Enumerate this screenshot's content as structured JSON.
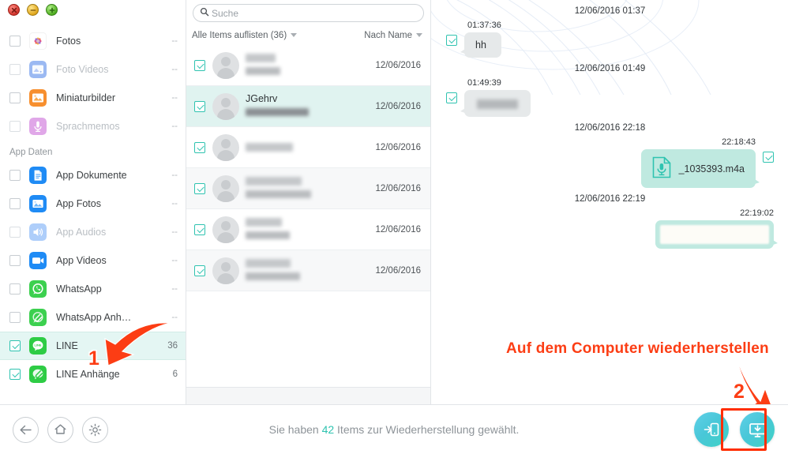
{
  "window": {
    "controls": [
      {
        "name": "close",
        "glyph": "x"
      },
      {
        "name": "minimize",
        "glyph": "-"
      },
      {
        "name": "maximize",
        "glyph": "+"
      }
    ]
  },
  "sidebar": {
    "items": [
      {
        "label": "Fotos",
        "icon": "photos-icon",
        "count": "--",
        "checked": false,
        "muted": false,
        "selected": false
      },
      {
        "label": "Foto Videos",
        "icon": "photo-videos-icon",
        "count": "--",
        "checked": false,
        "muted": true,
        "selected": false
      },
      {
        "label": "Miniaturbilder",
        "icon": "thumbnails-icon",
        "count": "--",
        "checked": false,
        "muted": false,
        "selected": false
      },
      {
        "label": "Sprachmemos",
        "icon": "voice-memos-icon",
        "count": "--",
        "checked": false,
        "muted": true,
        "selected": false
      }
    ],
    "group_label": "App Daten",
    "app_items": [
      {
        "label": "App Dokumente",
        "icon": "app-documents-icon",
        "count": "--",
        "checked": false,
        "muted": false,
        "selected": false
      },
      {
        "label": "App Fotos",
        "icon": "app-photos-icon",
        "count": "--",
        "checked": false,
        "muted": false,
        "selected": false
      },
      {
        "label": "App Audios",
        "icon": "app-audios-icon",
        "count": "--",
        "checked": false,
        "muted": true,
        "selected": false
      },
      {
        "label": "App Videos",
        "icon": "app-videos-icon",
        "count": "--",
        "checked": false,
        "muted": false,
        "selected": false
      },
      {
        "label": "WhatsApp",
        "icon": "whatsapp-icon",
        "count": "--",
        "checked": false,
        "muted": false,
        "selected": false
      },
      {
        "label": "WhatsApp Anh…",
        "icon": "whatsapp-attachments-icon",
        "count": "--",
        "checked": false,
        "muted": false,
        "selected": false
      },
      {
        "label": "LINE",
        "icon": "line-icon",
        "count": "36",
        "checked": true,
        "muted": false,
        "selected": true
      },
      {
        "label": "LINE Anhänge",
        "icon": "line-attachments-icon",
        "count": "6",
        "checked": true,
        "muted": false,
        "selected": false
      }
    ]
  },
  "search": {
    "placeholder": "Suche",
    "value": "",
    "icon": "search-icon"
  },
  "filterbar": {
    "list_filter": "Alle Items auflisten (36)",
    "sort_filter": "Nach Name"
  },
  "list": {
    "rows": [
      {
        "name": "",
        "blurred_name": true,
        "blurred_sub": true,
        "date": "12/06/2016",
        "checked": true,
        "selected": false,
        "alt": false
      },
      {
        "name": "JGehrv",
        "blurred_name": false,
        "blurred_sub": true,
        "date": "12/06/2016",
        "checked": true,
        "selected": true,
        "alt": false
      },
      {
        "name": "",
        "blurred_name": true,
        "blurred_sub": false,
        "date": "12/06/2016",
        "checked": true,
        "selected": false,
        "alt": false
      },
      {
        "name": "",
        "blurred_name": true,
        "blurred_sub": true,
        "date": "12/06/2016",
        "checked": true,
        "selected": false,
        "alt": true
      },
      {
        "name": "",
        "blurred_name": true,
        "blurred_sub": true,
        "date": "12/06/2016",
        "checked": true,
        "selected": false,
        "alt": false
      },
      {
        "name": "",
        "blurred_name": true,
        "blurred_sub": true,
        "date": "12/06/2016",
        "checked": true,
        "selected": false,
        "alt": true
      }
    ]
  },
  "chat": {
    "entries": [
      {
        "kind": "separator",
        "text": "12/06/2016 01:37"
      },
      {
        "kind": "message",
        "side": "in",
        "time": "01:37:36",
        "text": "hh",
        "blurred": false,
        "checked": true,
        "type": "text"
      },
      {
        "kind": "separator",
        "text": "12/06/2016 01:49"
      },
      {
        "kind": "message",
        "side": "in",
        "time": "01:49:39",
        "text": "",
        "blurred": true,
        "checked": true,
        "type": "text"
      },
      {
        "kind": "separator",
        "text": "12/06/2016 22:18"
      },
      {
        "kind": "message",
        "side": "out",
        "time": "22:18:43",
        "text": "_1035393.m4a",
        "blurred": false,
        "checked": true,
        "type": "audio-file",
        "file_icon": "audio-file-icon"
      },
      {
        "kind": "separator",
        "text": "12/06/2016 22:19"
      },
      {
        "kind": "message",
        "side": "out",
        "time": "22:19:02",
        "text": "",
        "blurred": true,
        "checked": false,
        "type": "image"
      }
    ]
  },
  "bottom": {
    "nav": [
      {
        "name": "back-button",
        "icon": "arrow-left-icon"
      },
      {
        "name": "home-button",
        "icon": "home-icon"
      },
      {
        "name": "settings-button",
        "icon": "gear-icon"
      }
    ],
    "status_prefix": "Sie haben ",
    "status_count": "42",
    "status_suffix": " Items zur Wiederherstellung gewählt.",
    "actions": [
      {
        "name": "restore-to-device-button",
        "icon": "device-restore-icon",
        "highlighted": false
      },
      {
        "name": "restore-to-computer-button",
        "icon": "computer-restore-icon",
        "highlighted": true
      }
    ]
  },
  "annotations": {
    "callout_text": "Auf dem Computer wiederherstellen",
    "step_one": "1",
    "step_two": "2",
    "color": "#fc3d14"
  },
  "colors": {
    "accent": "#2fc3b0",
    "selection": "#e4f6f3",
    "bubble_in": "#e6e9ea",
    "bubble_out": "#bfe9e0",
    "annotation_red": "#fc3d14"
  }
}
